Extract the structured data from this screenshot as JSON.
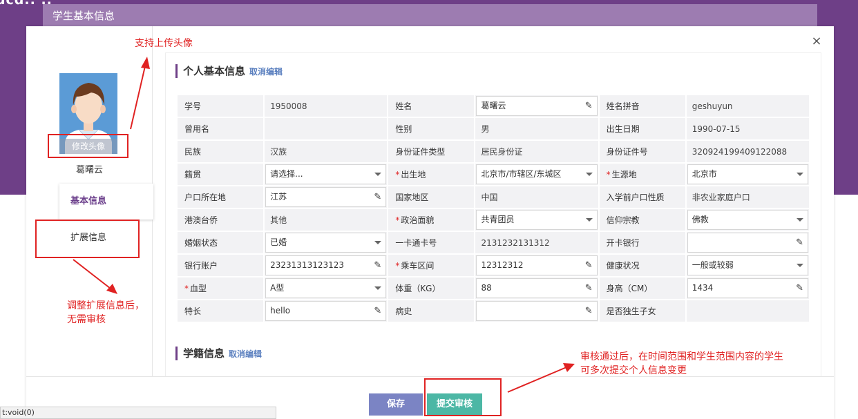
{
  "background": {
    "logo": "ucd.. ..",
    "panel_title": "学生基本信息"
  },
  "modal": {
    "close": "×"
  },
  "profile": {
    "avatar_edit": "修改头像",
    "name": "葛曙云"
  },
  "tabs": [
    {
      "label": "基本信息"
    },
    {
      "label": "扩展信息"
    }
  ],
  "sections": {
    "personal": {
      "title": "个人基本信息",
      "edit": "取消编辑"
    },
    "enrollment": {
      "title": "学籍信息",
      "edit": "取消编辑"
    }
  },
  "rows": [
    [
      {
        "label": "学号",
        "value": "1950008"
      },
      {
        "label": "姓名",
        "value": "葛曙云"
      },
      {
        "label": "姓名拼音",
        "value": "geshuyun"
      }
    ],
    [
      {
        "label": "曾用名",
        "value": ""
      },
      {
        "label": "性别",
        "value": "男"
      },
      {
        "label": "出生日期",
        "value": "1990-07-15"
      }
    ],
    [
      {
        "label": "民族",
        "value": "汉族"
      },
      {
        "label": "身份证件类型",
        "value": "居民身份证"
      },
      {
        "label": "身份证件号",
        "value": "320924199409122088"
      }
    ],
    [
      {
        "label": "籍贯",
        "value": "请选择..."
      },
      {
        "label": "出生地",
        "value": "北京市/市辖区/东城区"
      },
      {
        "label": "生源地",
        "value": "北京市"
      }
    ],
    [
      {
        "label": "户口所在地",
        "value": "江苏"
      },
      {
        "label": "国家地区",
        "value": "中国"
      },
      {
        "label": "入学前户口性质",
        "value": "非农业家庭户口"
      }
    ],
    [
      {
        "label": "港澳台侨",
        "value": "其他"
      },
      {
        "label": "政治面貌",
        "value": "共青团员"
      },
      {
        "label": "信仰宗教",
        "value": "佛教"
      }
    ],
    [
      {
        "label": "婚姻状态",
        "value": "已婚"
      },
      {
        "label": "一卡通卡号",
        "value": "2131232131312"
      },
      {
        "label": "开卡银行",
        "value": ""
      }
    ],
    [
      {
        "label": "银行账户",
        "value": "23231313123123"
      },
      {
        "label": "乘车区间",
        "value": "12312312"
      },
      {
        "label": "健康状况",
        "value": "一般或较弱"
      }
    ],
    [
      {
        "label": "血型",
        "value": "A型"
      },
      {
        "label": "体重（KG）",
        "value": "88"
      },
      {
        "label": "身高（CM）",
        "value": "1434"
      }
    ],
    [
      {
        "label": "特长",
        "value": "hello"
      },
      {
        "label": "病史",
        "value": ""
      },
      {
        "label": "是否独生子女",
        "value": ""
      }
    ]
  ],
  "buttons": {
    "save": "保存",
    "submit": "提交审核"
  },
  "annotations": {
    "avatar": "支持上传头像",
    "extended": [
      "调整扩展信息后，",
      "无需审核"
    ],
    "review": [
      "审核通过后，在时间范围和学生范围内容的学生",
      "可多次提交个人信息变更"
    ]
  },
  "status_bar": "t:void(0)",
  "colors": {
    "header_purple": "#6e3f87",
    "panel_purple": "#9d7cb1",
    "save_btn": "#7b84c4",
    "submit_btn": "#4cb7a5",
    "annotation_red": "#e02222",
    "required_star": "#e02222"
  }
}
